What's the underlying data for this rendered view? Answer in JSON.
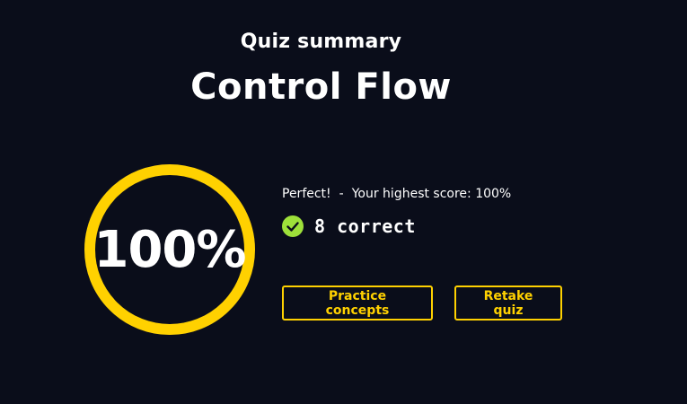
{
  "header": {
    "eyebrow": "Quiz summary",
    "title": "Control Flow"
  },
  "result": {
    "percent_label": "100%",
    "progress": 1.0,
    "message": "Perfect!",
    "separator": "-",
    "highest_score": "Your highest score: 100%",
    "correct_label": "8 correct"
  },
  "actions": {
    "practice_label": "Practice concepts",
    "retake_label": "Retake quiz"
  },
  "colors": {
    "background": "#0a0d1a",
    "accent": "#ffd100",
    "success": "#9ee03a"
  },
  "icons": {
    "check": "check-circle-icon"
  }
}
